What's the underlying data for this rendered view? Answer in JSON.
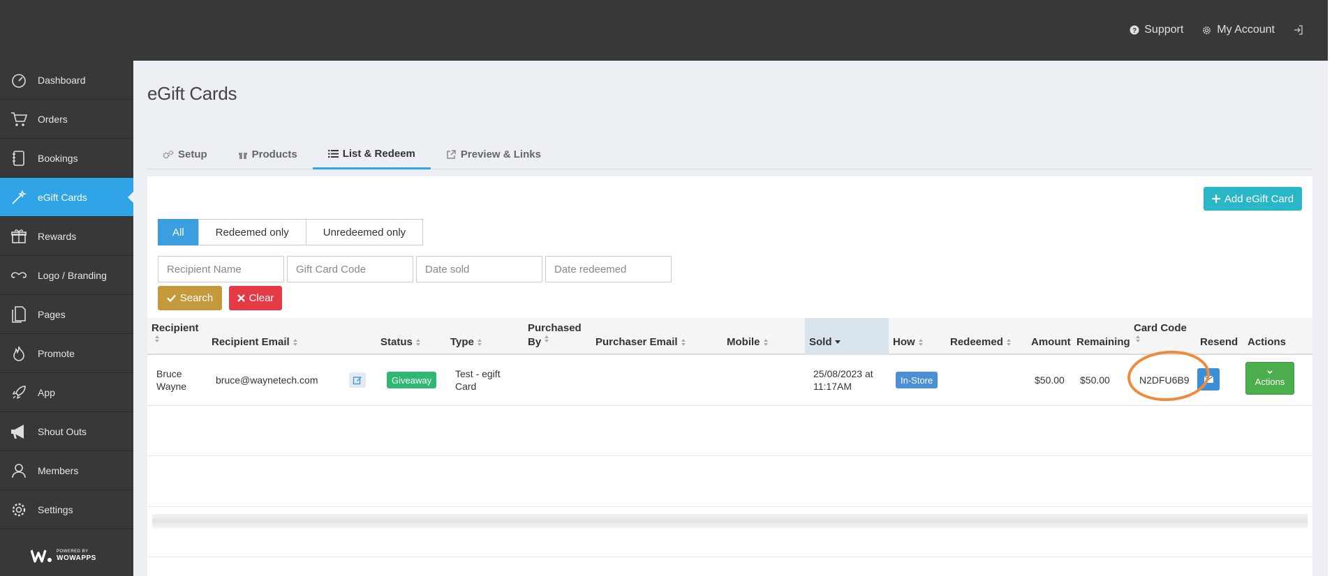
{
  "topbar": {
    "support_label": "Support",
    "account_label": "My Account"
  },
  "sidebar": {
    "items": [
      {
        "label": "Dashboard",
        "icon": "dashboard-icon"
      },
      {
        "label": "Orders",
        "icon": "cart-icon"
      },
      {
        "label": "Bookings",
        "icon": "book-icon"
      },
      {
        "label": "eGift Cards",
        "icon": "magic-wand-icon"
      },
      {
        "label": "Rewards",
        "icon": "gift-icon"
      },
      {
        "label": "Logo / Branding",
        "icon": "mustache-icon"
      },
      {
        "label": "Pages",
        "icon": "pages-icon"
      },
      {
        "label": "Promote",
        "icon": "fire-icon"
      },
      {
        "label": "App",
        "icon": "rocket-icon"
      },
      {
        "label": "Shout Outs",
        "icon": "megaphone-icon"
      },
      {
        "label": "Members",
        "icon": "user-icon"
      },
      {
        "label": "Settings",
        "icon": "gear-icon"
      }
    ],
    "powered_small": "POWERED BY",
    "powered_big": "WOWAPPS"
  },
  "page": {
    "title": "eGift Cards"
  },
  "tabs": [
    {
      "label": "Setup"
    },
    {
      "label": "Products"
    },
    {
      "label": "List & Redeem"
    },
    {
      "label": "Preview & Links"
    }
  ],
  "panel": {
    "add_button": "Add eGift Card",
    "filter_options": [
      "All",
      "Redeemed only",
      "Unredeemed only"
    ],
    "placeholders": {
      "recipient": "Recipient Name",
      "code": "Gift Card Code",
      "date_sold": "Date sold",
      "date_redeemed": "Date redeemed"
    },
    "search_button": "Search",
    "clear_button": "Clear"
  },
  "table": {
    "columns": {
      "recipient": "Recipient",
      "recipient_email": "Recipient Email",
      "status": "Status",
      "type": "Type",
      "purchased_by_1": "Purchased",
      "purchased_by_2": "By",
      "purchaser_email": "Purchaser Email",
      "mobile": "Mobile",
      "sold": "Sold",
      "how": "How",
      "redeemed": "Redeemed",
      "amount": "Amount",
      "remaining": "Remaining",
      "card_code": "Card Code",
      "resend": "Resend",
      "actions": "Actions"
    },
    "rows": [
      {
        "recipient_1": "Bruce",
        "recipient_2": "Wayne",
        "email": "bruce@waynetech.com",
        "status": "Giveaway",
        "type_1": "Test - egift",
        "type_2": "Card",
        "sold_1": "25/08/2023 at",
        "sold_2": "11:17AM",
        "how": "In-Store",
        "amount": "$50.00",
        "remaining": "$50.00",
        "card_code": "N2DFU6B9",
        "actions": "Actions"
      }
    ]
  },
  "colors": {
    "accent": "#2fa4e7",
    "giveaway": "#2eb872",
    "in_store": "#4a90d9",
    "search": "#c49a3c",
    "clear": "#e63946",
    "add": "#29b6c6",
    "actions": "#4cae4c",
    "annotation": "#f08a3c"
  }
}
